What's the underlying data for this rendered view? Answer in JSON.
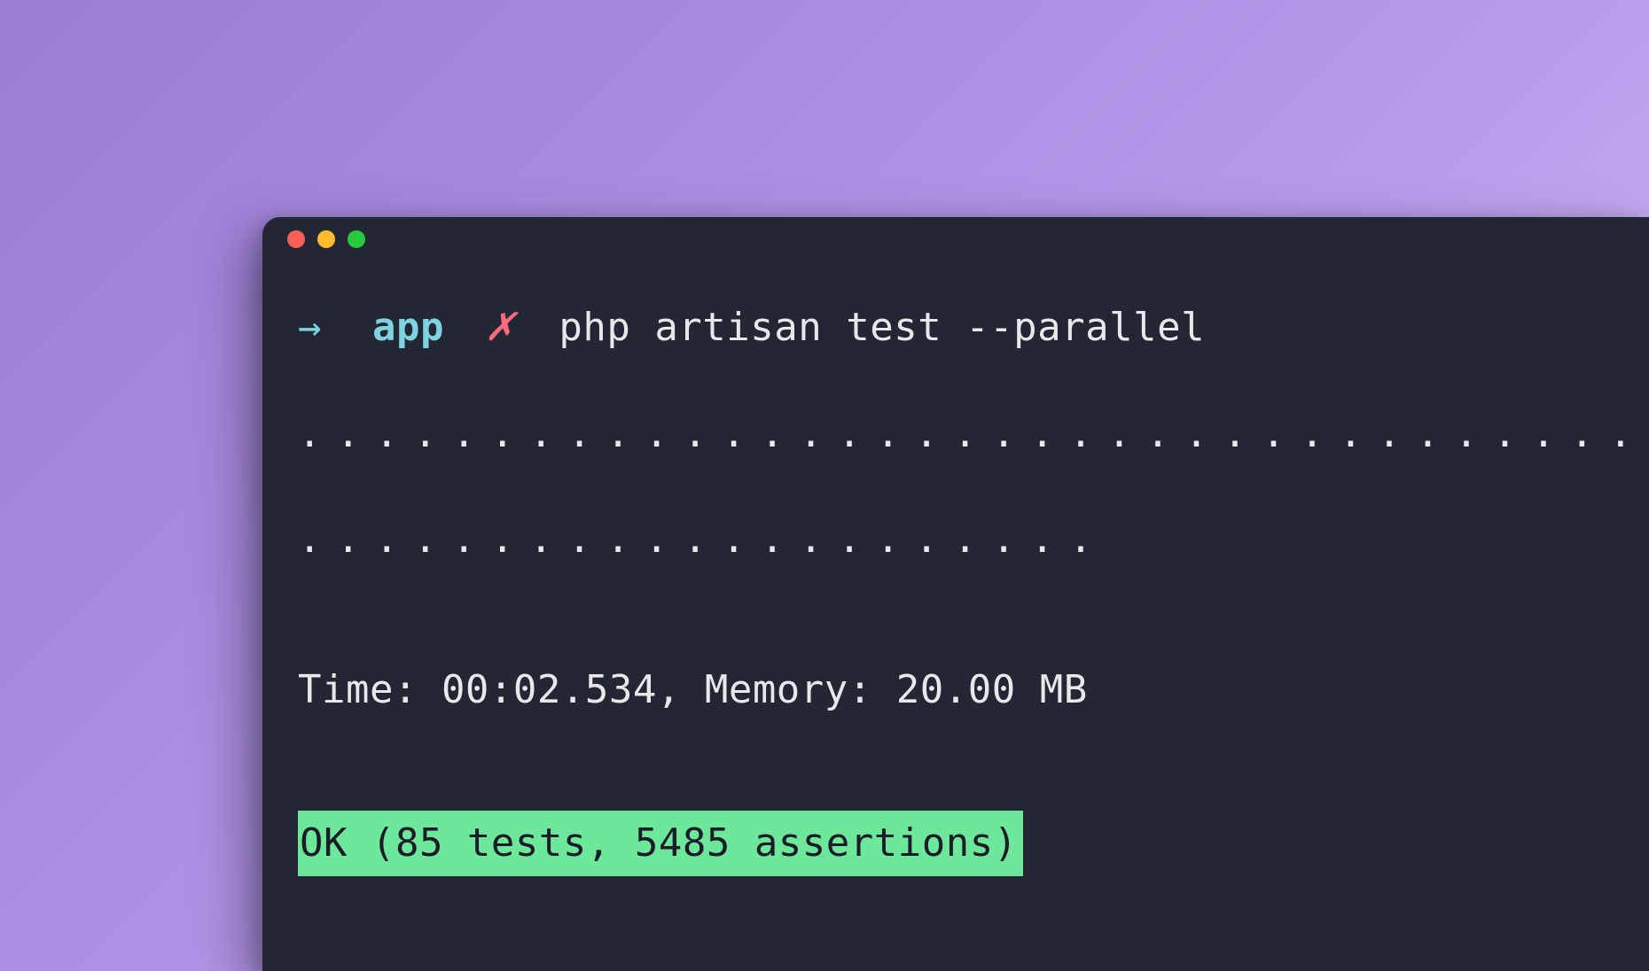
{
  "terminal": {
    "prompt": {
      "arrow": "→",
      "cwd": "app",
      "git_status": "✗",
      "command": "php artisan test --parallel"
    },
    "output": {
      "dots_line_1": "........................................................",
      "dots_line_2": ".....................",
      "stats": "Time: 00:02.534, Memory: 20.00 MB",
      "result": "OK (85 tests, 5485 assertions)"
    }
  },
  "test_data": {
    "time": "00:02.534",
    "memory": "20.00 MB",
    "status": "OK",
    "tests": 85,
    "assertions": 5485
  }
}
